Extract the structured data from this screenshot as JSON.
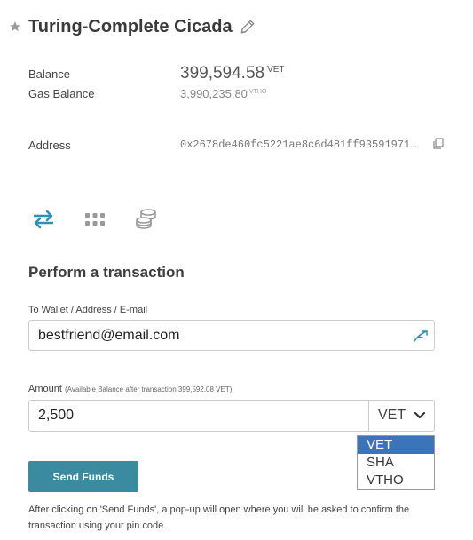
{
  "wallet": {
    "name": "Turing-Complete Cicada"
  },
  "balances": {
    "balance_label": "Balance",
    "balance_value": "399,594.58",
    "balance_unit": "VET",
    "gas_label": "Gas Balance",
    "gas_value": "3,990,235.80",
    "gas_unit": "VTHO"
  },
  "address": {
    "label": "Address",
    "value": "0x2678de460fc5221ae8c6d481ff93591971…"
  },
  "tabs": [
    {
      "icon": "transfer-arrows-icon",
      "active": true
    },
    {
      "icon": "grid-icon",
      "active": false
    },
    {
      "icon": "coins-stack-icon",
      "active": false
    }
  ],
  "transaction": {
    "title": "Perform a transaction",
    "to_label": "To Wallet / Address / E-mail",
    "to_value": "bestfriend@email.com",
    "amount_label": "Amount",
    "amount_hint": "(Available Balance after transaction 399,592.08 VET)",
    "amount_value": "2,500",
    "currency_selected": "VET",
    "currency_options": [
      "VET",
      "SHA",
      "VTHO"
    ],
    "send_label": "Send Funds",
    "help_text": "After clicking on 'Send Funds', a pop-up will open where you will be asked to confirm the transaction using your pin code."
  },
  "colors": {
    "accent": "#3a8aa0",
    "active_tab": "#2f8fb3",
    "dropdown_selected": "#3b74b8"
  }
}
